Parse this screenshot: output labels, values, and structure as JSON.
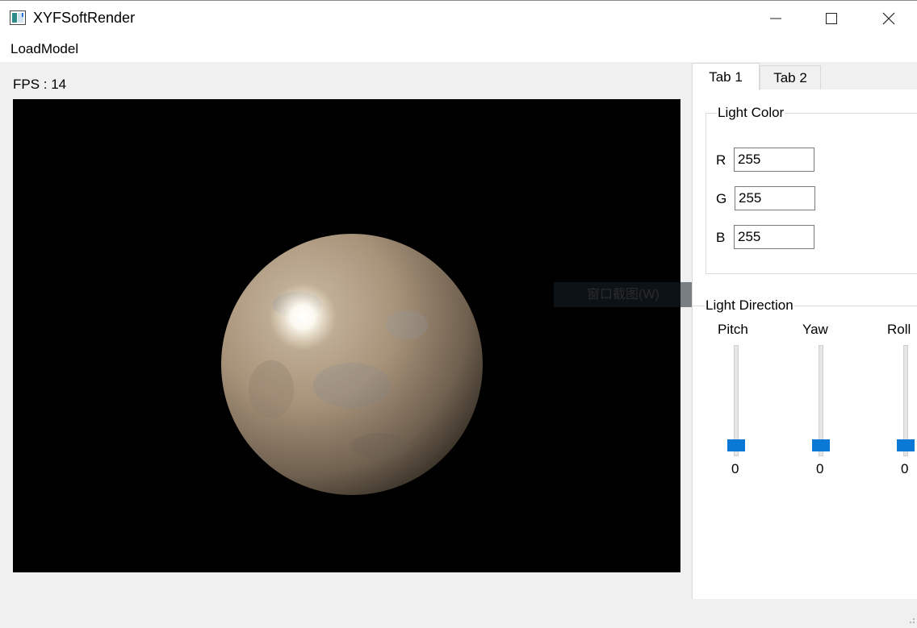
{
  "window": {
    "title": "XYFSoftRender",
    "controls": [
      "minimize-icon",
      "maximize-icon",
      "close-icon"
    ]
  },
  "menu": {
    "items": [
      {
        "label": "LoadModel"
      }
    ]
  },
  "status": {
    "fps_text": "FPS : 14"
  },
  "viewport": {
    "content": "rendered-textured-sphere",
    "background": "#000000"
  },
  "overlay": {
    "snip_tooltip": "窗口截图(W)"
  },
  "tabs": [
    {
      "label": "Tab 1",
      "active": true
    },
    {
      "label": "Tab 2",
      "active": false
    }
  ],
  "light_color": {
    "title": "Light Color",
    "channels": [
      {
        "label": "R",
        "value": "255"
      },
      {
        "label": "G",
        "value": "255"
      },
      {
        "label": "B",
        "value": "255"
      }
    ]
  },
  "light_direction": {
    "title": "Light Direction",
    "sliders": [
      {
        "label": "Pitch",
        "value": "0"
      },
      {
        "label": "Yaw",
        "value": "0"
      },
      {
        "label": "Roll",
        "value": "0"
      }
    ]
  },
  "colors": {
    "accent": "#0a79d6",
    "window_bg": "#f0f0f0"
  }
}
